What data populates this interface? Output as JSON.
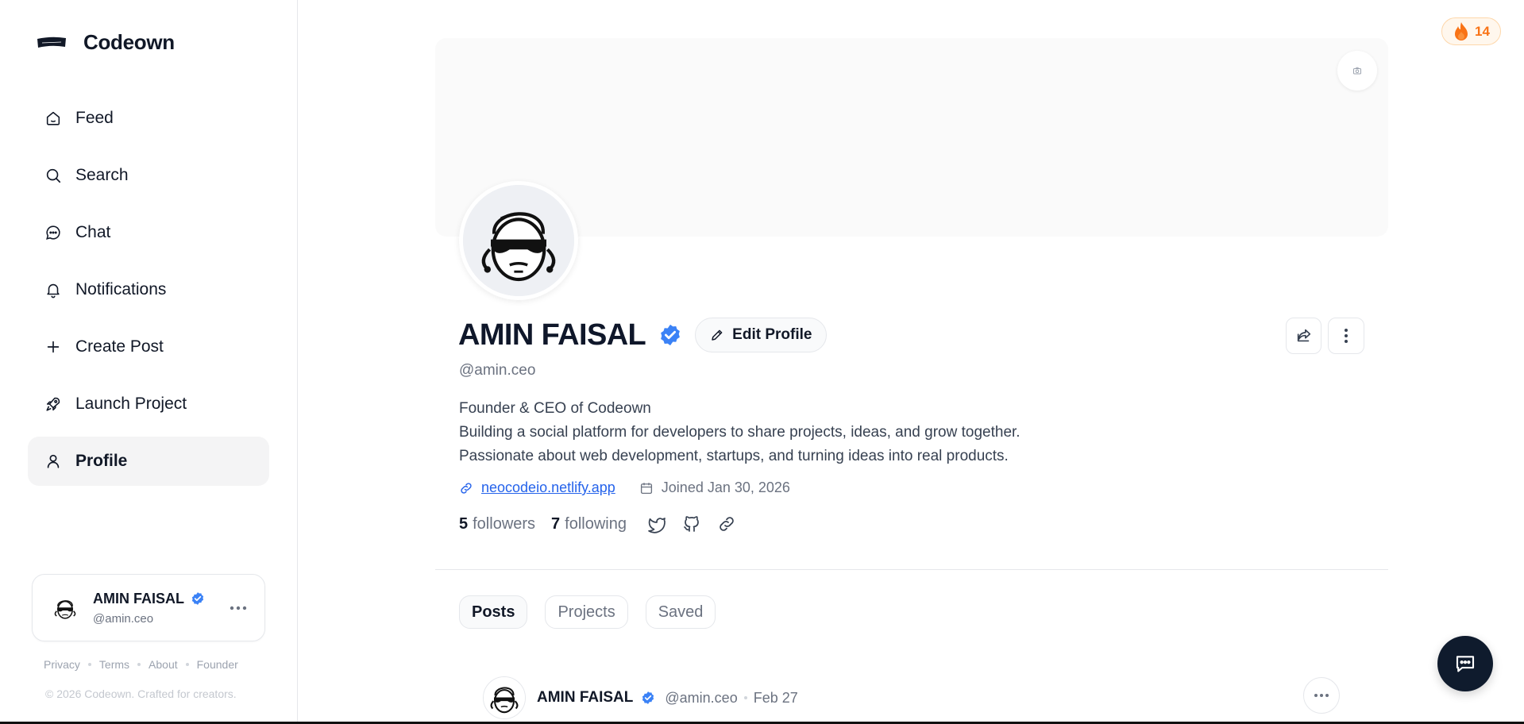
{
  "app": {
    "name": "Codeown"
  },
  "sidebar": {
    "items": [
      {
        "label": "Feed",
        "icon": "home-icon"
      },
      {
        "label": "Search",
        "icon": "search-icon"
      },
      {
        "label": "Chat",
        "icon": "chat-icon"
      },
      {
        "label": "Notifications",
        "icon": "bell-icon"
      },
      {
        "label": "Create Post",
        "icon": "plus-icon"
      },
      {
        "label": "Launch Project",
        "icon": "rocket-icon"
      },
      {
        "label": "Profile",
        "icon": "user-icon",
        "active": true
      }
    ],
    "user": {
      "name": "AMIN FAISAL",
      "handle": "@amin.ceo"
    },
    "footer": {
      "links": [
        "Privacy",
        "Terms",
        "About",
        "Founder"
      ],
      "copyright": "© 2026 Codeown. Crafted for creators."
    }
  },
  "streak": {
    "count": "14",
    "icon": "fire-icon",
    "color": "#f97316"
  },
  "profile": {
    "name": "AMIN FAISAL",
    "edit_label": "Edit Profile",
    "handle": "@amin.ceo",
    "bio": [
      "Founder & CEO of Codeown",
      "Building a social platform for developers to share projects, ideas, and grow together.",
      "Passionate about web development, startups, and turning ideas into real products."
    ],
    "website": "neocodeio.netlify.app",
    "joined": "Joined Jan 30, 2026",
    "followers_count": "5",
    "followers_label": "followers",
    "following_count": "7",
    "following_label": "following",
    "socials": [
      "twitter-icon",
      "github-icon",
      "link-icon"
    ]
  },
  "tabs": [
    "Posts",
    "Projects",
    "Saved"
  ],
  "post": {
    "name": "AMIN FAISAL",
    "handle": "@amin.ceo",
    "date": "Feb 27"
  },
  "colors": {
    "accent": "#2563eb",
    "verified": "#3b82f6",
    "fab": "#0f1b2d"
  }
}
